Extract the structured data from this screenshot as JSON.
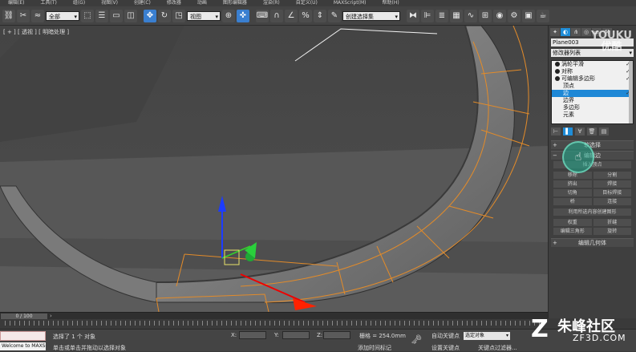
{
  "menu": {
    "items": [
      "编辑(E)",
      "工具(T)",
      "组(G)",
      "视图(V)",
      "创建(C)",
      "修改器",
      "动画",
      "图形编辑器",
      "渲染(R)",
      "自定义(U)",
      "MAXScript(M)",
      "帮助(H)"
    ]
  },
  "toolbar": {
    "filter_select": "全部",
    "view_select": "视图",
    "named_selection": "创建选择集"
  },
  "viewport": {
    "label": "[ + ] [ 透视 ] [ 明暗处理 ]"
  },
  "command_panel": {
    "object_name": "Plane003",
    "modifier_list": "修改器列表",
    "stack": [
      {
        "label": "涡轮平滑",
        "level": 0
      },
      {
        "label": "对称",
        "level": 0
      },
      {
        "label": "可编辑多边形",
        "level": 0
      },
      {
        "label": "顶点",
        "level": 1
      },
      {
        "label": "边",
        "level": 1,
        "selected": true
      },
      {
        "label": "边界",
        "level": 1
      },
      {
        "label": "多边形",
        "level": 1
      },
      {
        "label": "元素",
        "level": 1
      }
    ],
    "rollouts": [
      "软选择",
      "编辑边"
    ],
    "buttons": [
      "插入顶点",
      "移除",
      "分割",
      "挤出",
      "焊接",
      "切角",
      "目标焊接",
      "桥",
      "连接",
      "利用所选内容创建图形",
      "权重",
      "折缝",
      "编辑三角形",
      "旋转",
      "编辑几何体"
    ],
    "watermark": "YOUKU 优酷"
  },
  "timeline": {
    "position": "0 / 100"
  },
  "status": {
    "maxscript_listener": "Welcome to MAXScript.",
    "selection_info": "选择了 1 个 对象",
    "prompt": "单击或单击并拖动以选择对象",
    "x_label": "X:",
    "y_label": "Y:",
    "z_label": "Z:",
    "grid": "栅格 = 254.0mm",
    "auto_key": "自动关键点",
    "set_key": "设置关键点",
    "selected_object": "选定对象",
    "add_time_tag": "添加时间标记",
    "key_filters": "关键点过滤器..."
  },
  "branding": {
    "site_cn": "朱峰社区",
    "site_en": "ZF3D.COM"
  }
}
